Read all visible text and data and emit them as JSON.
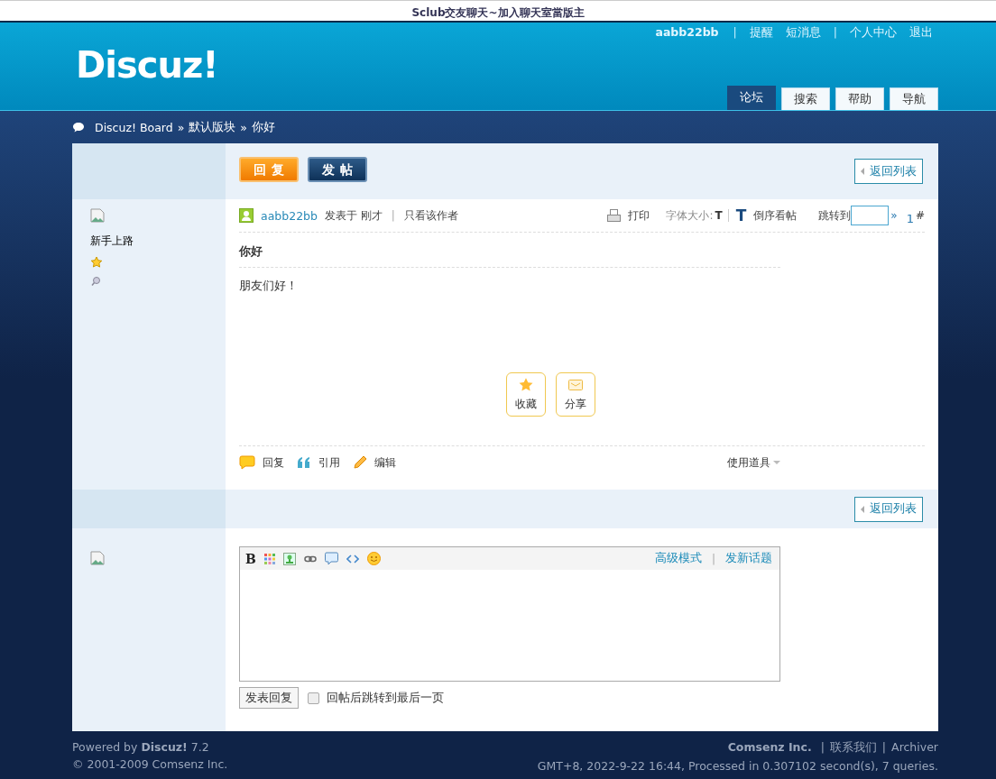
{
  "top_banner": {
    "text": "Sclub交友聊天~加入聊天室當版主"
  },
  "header": {
    "logo": "Discuz!",
    "user_links": [
      {
        "kind": "user",
        "label": "aabb22bb"
      },
      {
        "kind": "sep",
        "label": "|"
      },
      {
        "kind": "link",
        "label": "提醒"
      },
      {
        "kind": "link",
        "label": "短消息"
      },
      {
        "kind": "sep",
        "label": "|"
      },
      {
        "kind": "link",
        "label": "个人中心"
      },
      {
        "kind": "link",
        "label": "退出"
      }
    ],
    "tabs": [
      {
        "label": "论坛",
        "selected": true
      },
      {
        "label": "搜索",
        "selected": false
      },
      {
        "label": "帮助",
        "selected": false
      },
      {
        "label": "导航",
        "selected": false
      }
    ]
  },
  "breadcrumb": {
    "separator": "»",
    "items": [
      "Discuz! Board",
      "默认版块",
      "你好"
    ]
  },
  "thread_toolbar": {
    "buttons": [
      {
        "kind": "reply",
        "label": "回复"
      },
      {
        "kind": "new",
        "label": "发帖"
      }
    ],
    "back_link": "返回列表"
  },
  "post": {
    "rank": "新手上路",
    "author": "aabb22bb",
    "posted": "发表于 刚才",
    "separator": "|",
    "only_author": "只看该作者",
    "print": "打印",
    "font_size_label": "字体大小:",
    "font_small": "T",
    "font_large": "T",
    "reverse": "倒序看帖",
    "jump_label": "跳转到",
    "jump_go": "»",
    "floor": "1",
    "floor_mark": "#",
    "title": "你好",
    "body": "朋友们好！",
    "share_buttons": [
      {
        "kind": "favorite",
        "label": "收藏"
      },
      {
        "kind": "share",
        "label": "分享"
      }
    ],
    "actions": [
      {
        "kind": "reply",
        "label": "回复"
      },
      {
        "kind": "quote",
        "label": "引用"
      },
      {
        "kind": "edit",
        "label": "编辑"
      }
    ],
    "tools": "使用道具"
  },
  "bottom_toolbar": {
    "back_link": "返回列表"
  },
  "reply_editor": {
    "bold": "B",
    "separator": "|",
    "links": [
      "高级模式",
      "发新话题"
    ],
    "submit": "发表回复",
    "jump_checkbox": {
      "label": "回帖后跳转到最后一页",
      "checked": false
    }
  },
  "footer": {
    "powered": "Powered by **Discuz!** 7.2",
    "copyright": "© 2001-2009 Comsenz Inc.",
    "company": "Comsenz Inc.",
    "links": [
      {
        "sep": "|",
        "label": "联系我们"
      },
      {
        "sep": "|",
        "label": "Archiver"
      }
    ],
    "stats": "GMT+8, 2022-9-22 16:44, Processed in 0.307102 second(s), 7 queries."
  }
}
